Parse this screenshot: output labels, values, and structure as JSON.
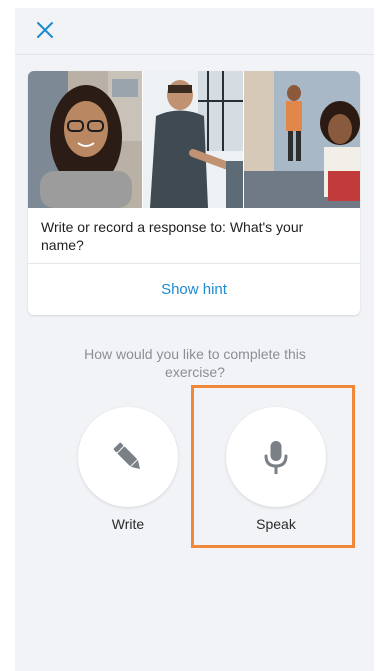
{
  "header": {
    "close_icon": "close-icon",
    "accent_color": "#1f8ad1"
  },
  "exercise": {
    "prompt": "Write or record a response to: What's your name?",
    "hint_label": "Show hint"
  },
  "choice": {
    "question": "How would you like to complete this exercise?",
    "options": [
      {
        "label": "Write",
        "icon": "pencil-icon"
      },
      {
        "label": "Speak",
        "icon": "microphone-icon"
      }
    ],
    "highlight_color": "#f0883a"
  }
}
